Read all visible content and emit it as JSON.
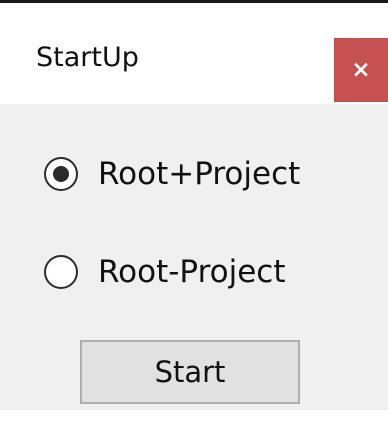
{
  "window": {
    "title": "StartUp",
    "close_glyph": "×",
    "close_color": "#c75050",
    "client_background": "#f0f0f0"
  },
  "options": [
    {
      "label": "Root+Project",
      "selected": true
    },
    {
      "label": "Root-Project",
      "selected": false
    }
  ],
  "actions": {
    "start_label": "Start"
  }
}
